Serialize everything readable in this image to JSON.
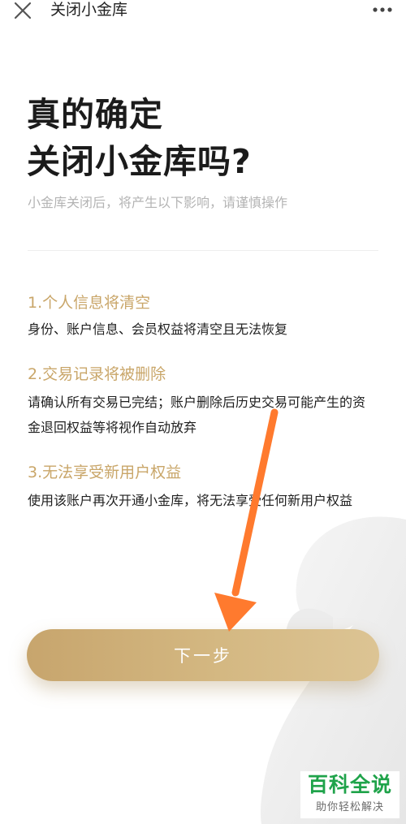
{
  "nav": {
    "title": "关闭小金库",
    "close_icon": "close-icon",
    "more_icon": "more-icon"
  },
  "heading": {
    "line1": "真的确定",
    "line2": "关闭小金库吗?"
  },
  "subtitle": "小金库关闭后，将产生以下影响，请谨慎操作",
  "items": [
    {
      "title": "1.个人信息将清空",
      "desc": "身份、账户信息、会员权益将清空且无法恢复"
    },
    {
      "title": "2.交易记录将被删除",
      "desc": "请确认所有交易已完结；账户删除后历史交易可能产生的资金退回权益等将视作自动放弃"
    },
    {
      "title": "3.无法享受新用户权益",
      "desc": "使用该账户再次开通小金库，将无法享受任何新用户权益"
    }
  ],
  "button": {
    "label": "下一步"
  },
  "watermark": {
    "brand": "百科全说",
    "slogan": "助你轻松解决"
  },
  "colors": {
    "accent_gold": "#c9a669",
    "annotation_arrow": "#ff7a2e",
    "watermark_green": "#1fa34a"
  }
}
